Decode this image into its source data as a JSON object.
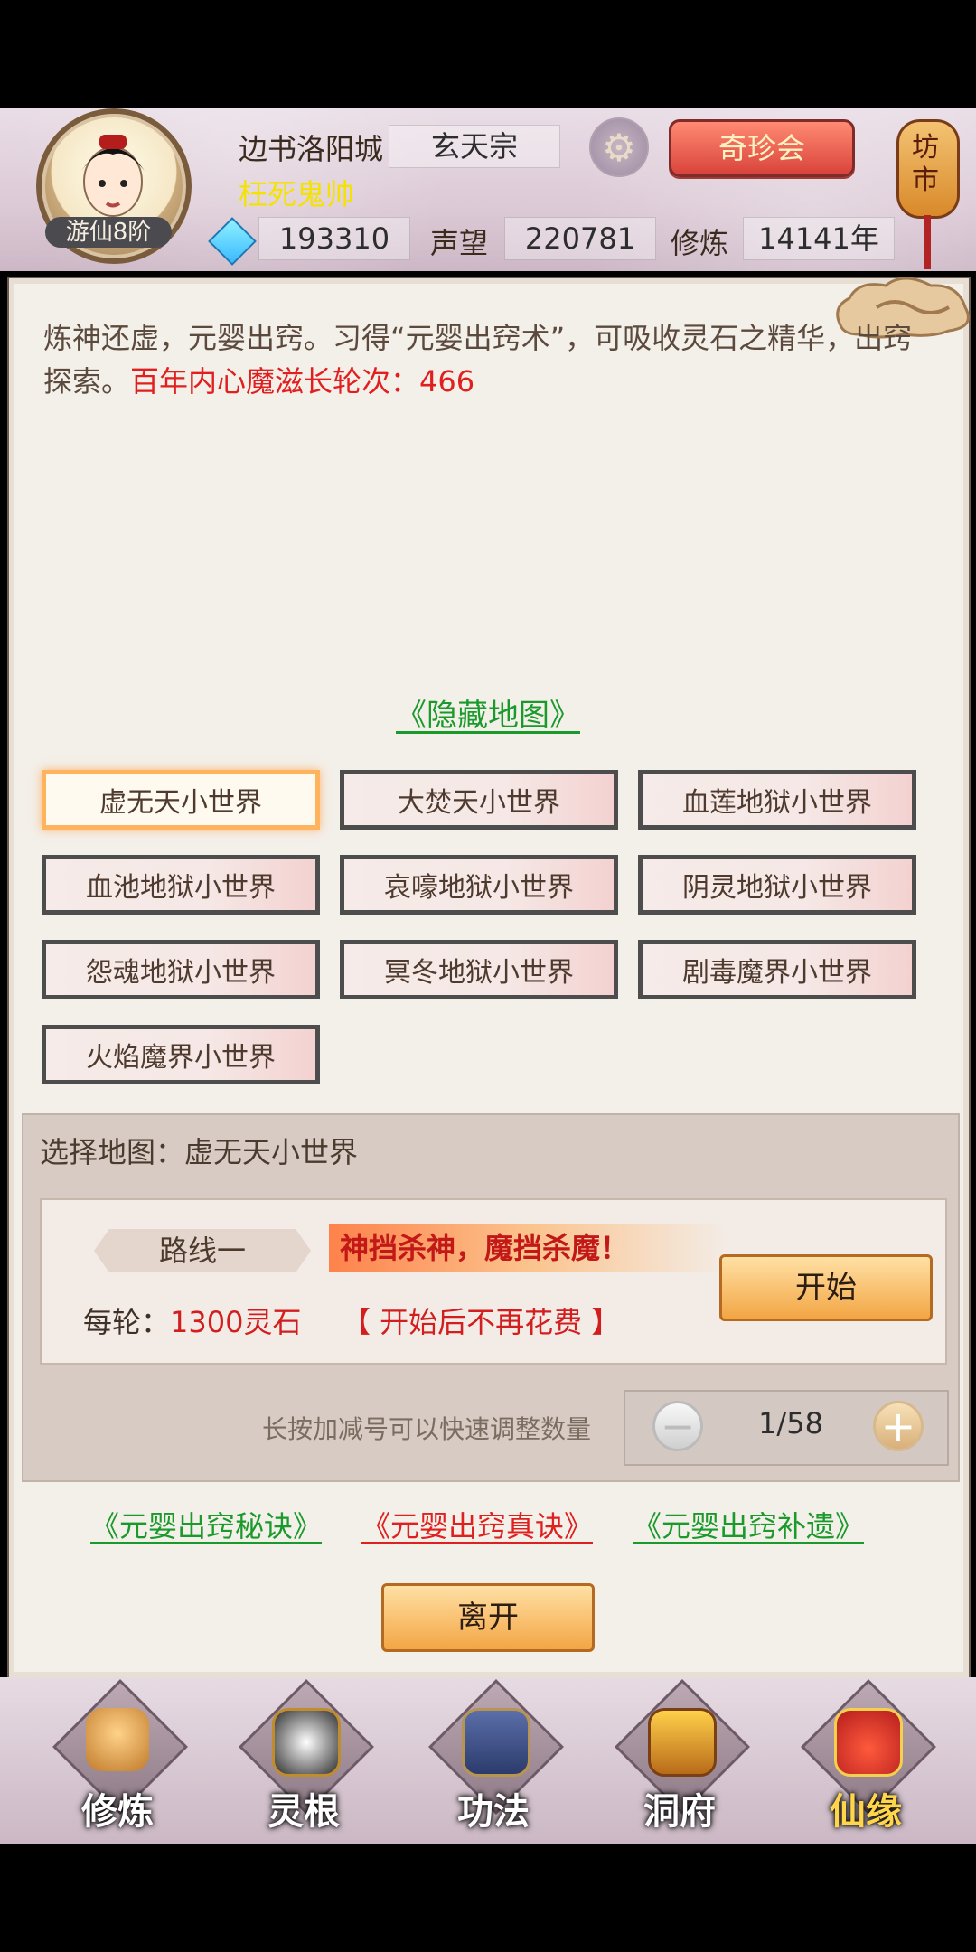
{
  "header": {
    "location": "边书洛阳城",
    "sect": "玄天宗",
    "player_title": "枉死鬼帅",
    "level_badge": "游仙8阶",
    "spirit_stones": "193310",
    "reputation_label": "声望",
    "reputation": "220781",
    "cultivation_label": "修炼",
    "cultivation": "14141年",
    "qizhen_button": "奇珍会",
    "lantern_text": "坊市"
  },
  "intro": {
    "text": "炼神还虚，元婴出窍。习得“元婴出窍术”，可吸收灵石之精华，出窍探索。",
    "red": "百年内心魔滋长轮次：466"
  },
  "hidden_map_link": "《隐藏地图》",
  "maps": [
    "虚无天小世界",
    "大焚天小世界",
    "血莲地狱小世界",
    "血池地狱小世界",
    "哀嚎地狱小世界",
    "阴灵地狱小世界",
    "怨魂地狱小世界",
    "冥冬地狱小世界",
    "剧毒魔界小世界",
    "火焰魔界小世界"
  ],
  "selection": {
    "title": "选择地图：虚无天小世界",
    "route_label": "路线一",
    "slogan": "神挡杀神，魔挡杀魔！",
    "per_round_label": "每轮：",
    "per_round_cost": "1300灵石",
    "no_fee": "【 开始后不再花费 】",
    "start_button": "开始",
    "hint": "长按加减号可以快速调整数量",
    "count": "1/58"
  },
  "links": {
    "secret": "《元婴出窍秘诀》",
    "true": "《元婴出窍真诀》",
    "supplement": "《元婴出窍补遗》"
  },
  "leave_button": "离开",
  "nav": {
    "items": [
      "修炼",
      "灵根",
      "功法",
      "洞府",
      "仙缘"
    ]
  }
}
